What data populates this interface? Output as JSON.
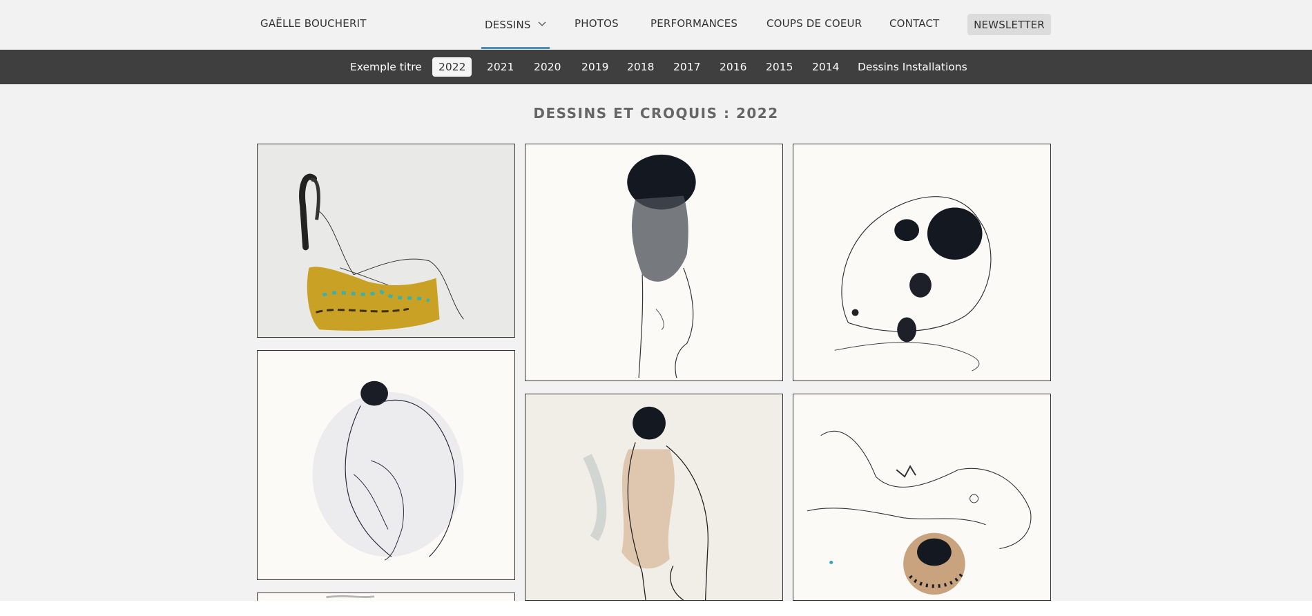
{
  "header": {
    "brand": "GAËLLE BOUCHERIT",
    "menu": [
      {
        "label": "DESSINS",
        "active": true
      },
      {
        "label": "PHOTOS"
      },
      {
        "label": "PERFORMANCES"
      },
      {
        "label": "COUPS DE COEUR"
      },
      {
        "label": "CONTACT"
      }
    ],
    "newsletter": "NEWSLETTER",
    "icons": {
      "dropdown": "chevron-down-icon"
    }
  },
  "subnav": {
    "items": [
      "Exemple titre",
      "2022",
      "2021",
      "2020",
      "2019",
      "2018",
      "2017",
      "2016",
      "2015",
      "2014",
      "Dessins Installations"
    ],
    "active": "2022"
  },
  "main": {
    "title": "DESSINS ET CROQUIS : 2022",
    "gallery": [
      {
        "subject": "seated-figure-yellow-ink"
      },
      {
        "subject": "standing-figure-black-ink-head"
      },
      {
        "subject": "curled-figure-black-ink-spots"
      },
      {
        "subject": "crouching-figure-line-drawing"
      },
      {
        "subject": "standing-figure-ochre-wash"
      },
      {
        "subject": "reclining-figure-ochre-circle"
      },
      {
        "subject": "partial-drawing"
      }
    ]
  },
  "colors": {
    "page_bg": "#f2f2f2",
    "subnav_bg": "#3f3f3f",
    "accent_underline": "#4a90b5",
    "newsletter_bg": "#dcdcdc"
  }
}
